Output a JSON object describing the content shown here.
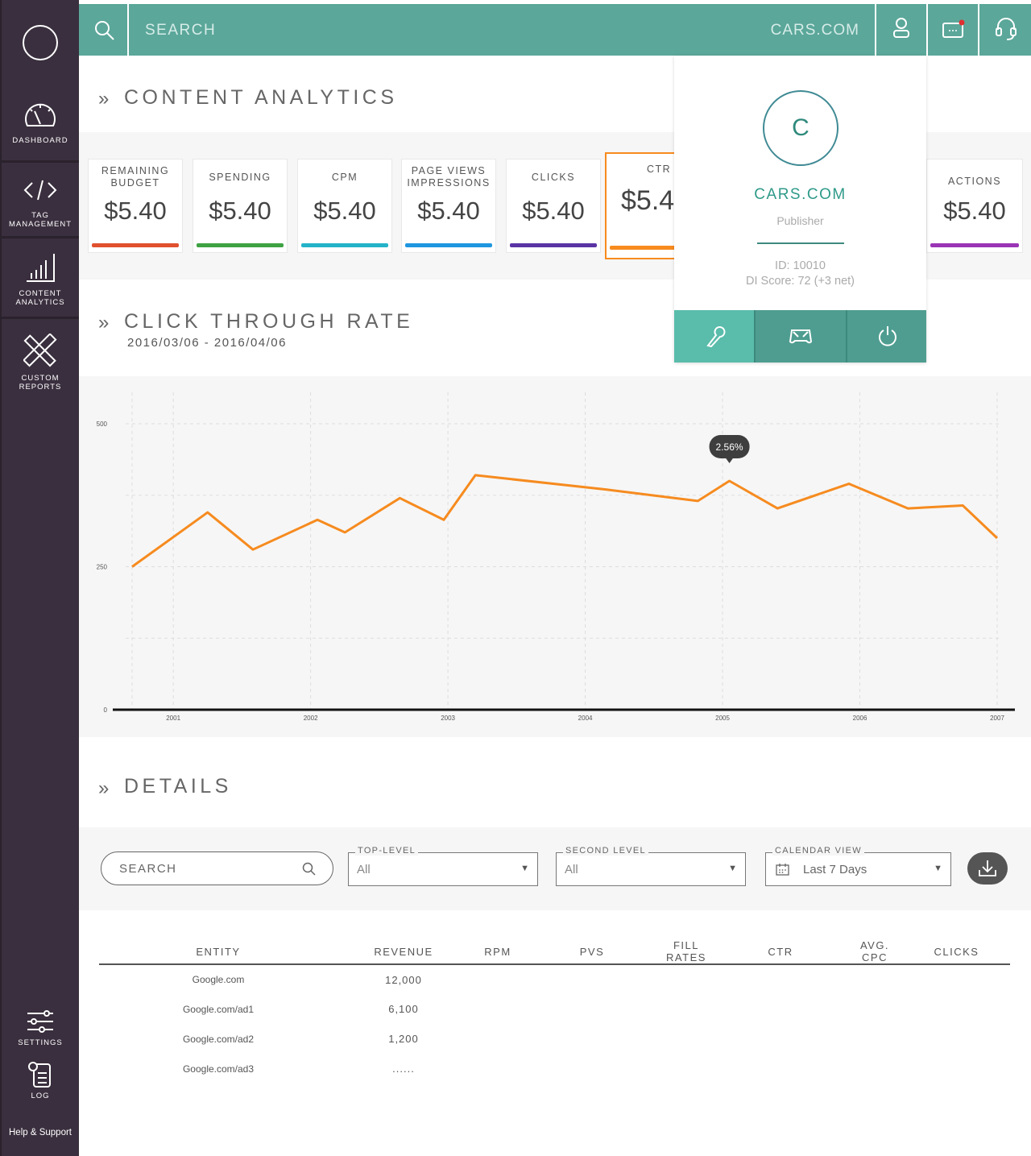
{
  "sidebar": {
    "items": [
      {
        "label": "DASHBOARD",
        "icon": "speedometer-icon"
      },
      {
        "label": "TAG\nMANAGEMENT",
        "icon": "code-icon"
      },
      {
        "label": "CONTENT\nANALYTICS",
        "icon": "bar-chart-icon"
      },
      {
        "label": "CUSTOM\nREPORTS",
        "icon": "pencil-ruler-icon"
      }
    ],
    "bottom": [
      {
        "label": "SETTINGS",
        "icon": "sliders-icon"
      },
      {
        "label": "LOG",
        "icon": "log-icon"
      }
    ],
    "help": "Help & Support"
  },
  "topbar": {
    "search_placeholder": "SEARCH",
    "brand": "CARS.COM"
  },
  "content_analytics": {
    "title": "CONTENT ANALYTICS",
    "cards": [
      {
        "label": "REMAINING BUDGET",
        "value": "$5.40",
        "color": "#e0502f"
      },
      {
        "label": "SPENDING",
        "value": "$5.40",
        "color": "#3ea243"
      },
      {
        "label": "CPM",
        "value": "$5.40",
        "color": "#24b3c8"
      },
      {
        "label": "PAGE VIEWS IMPRESSIONS",
        "value": "$5.40",
        "color": "#1f96df"
      },
      {
        "label": "CLICKS",
        "value": "$5.40",
        "color": "#5a34a4"
      },
      {
        "label": "CTR",
        "value": "$5.40",
        "color": "#f78b1e"
      },
      {
        "label": "ACTIONS",
        "value": "$5.40",
        "color": "#9a35b5"
      }
    ]
  },
  "profile": {
    "initial": "C",
    "name": "CARS.COM",
    "role": "Publisher",
    "id": "ID: 10010",
    "score": "DI Score: 72 (+3 net)",
    "actions": [
      "wrench-icon",
      "gamepad-icon",
      "power-icon"
    ]
  },
  "ctr_section": {
    "title": "CLICK THROUGH RATE",
    "date_range": "2016/03/06 - 2016/04/06"
  },
  "chart_data": {
    "type": "line",
    "title": "",
    "xlabel": "",
    "ylabel": "",
    "ylim": [
      0,
      500
    ],
    "yticks": [
      0,
      250,
      500
    ],
    "xlim": [
      2000.7,
      2007
    ],
    "xticks": [
      2001,
      2002,
      2003,
      2004,
      2005,
      2006,
      2007
    ],
    "grid": true,
    "series": [
      {
        "color": "#f68b1f",
        "x": [
          2000.7,
          2001.25,
          2001.58,
          2002.05,
          2002.25,
          2002.65,
          2002.97,
          2003.2,
          2004.15,
          2004.82,
          2005.05,
          2005.4,
          2005.92,
          2006.35,
          2006.75,
          2007.0
        ],
        "y": [
          250,
          345,
          280,
          332,
          310,
          370,
          332,
          410,
          385,
          365,
          400,
          352,
          395,
          352,
          357,
          300
        ]
      }
    ],
    "tooltip": {
      "x": 2005.05,
      "y": 400,
      "text": "2.56%"
    }
  },
  "details": {
    "title": "DETAILS",
    "search_placeholder": "SEARCH",
    "dropdowns": [
      {
        "label": "TOP-LEVEL",
        "value": "All"
      },
      {
        "label": "SECOND LEVEL",
        "value": "All"
      },
      {
        "label": "CALENDAR VIEW",
        "value": "Last 7 Days"
      }
    ],
    "columns": [
      "ENTITY",
      "REVENUE",
      "RPM",
      "PVS",
      "FILL RATES",
      "CTR",
      "AVG. CPC",
      "CLICKS"
    ],
    "rows": [
      [
        "Google.com",
        "12,000",
        "",
        "",
        "",
        "",
        "",
        ""
      ],
      [
        "Google.com/ad1",
        "6,100",
        "",
        "",
        "",
        "",
        "",
        ""
      ],
      [
        "Google.com/ad2",
        "1,200",
        "",
        "",
        "",
        "",
        "",
        ""
      ],
      [
        "Google.com/ad3",
        "......",
        "",
        "",
        "",
        "",
        "",
        ""
      ]
    ]
  }
}
